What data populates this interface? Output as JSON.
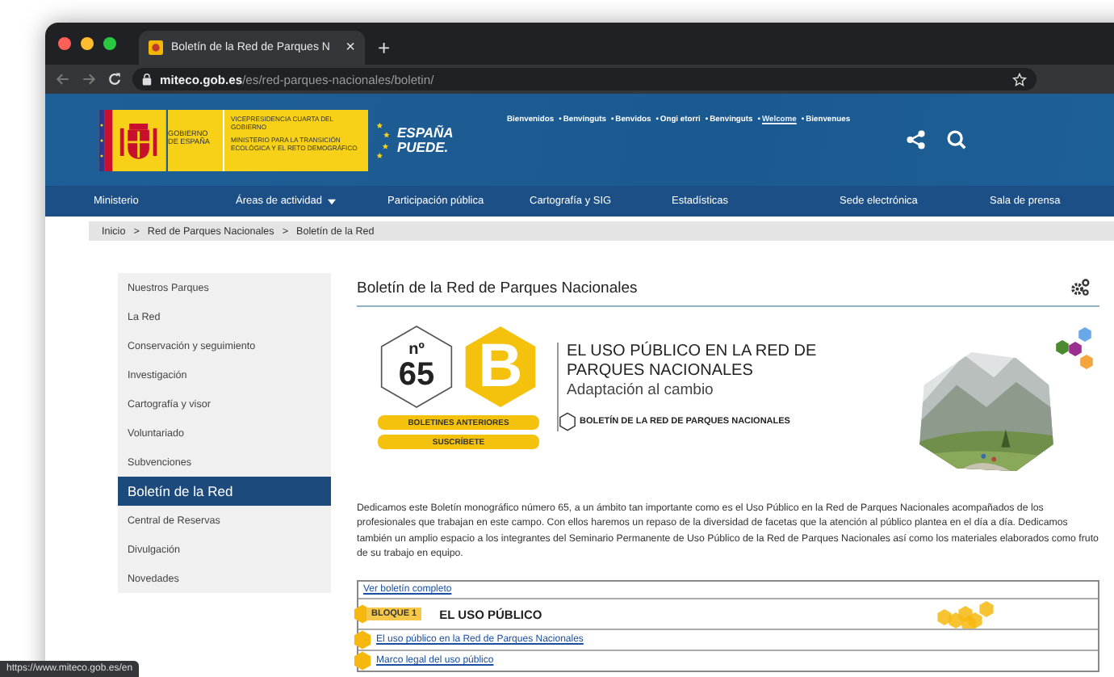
{
  "browser": {
    "tabs": [
      {
        "title": "Boletín de la Red de Parques N",
        "selected": true,
        "close": "×"
      }
    ],
    "new_tab": "+",
    "url": {
      "host": "miteco.gob.es",
      "path": "/es/red-parques-nacionales/boletin/"
    }
  },
  "header": {
    "logo": {
      "government": "GOBIERNO DE ESPAÑA",
      "vice": "VICEPRESIDENCIA CUARTA DEL GOBIERNO",
      "ministry": "MINISTERIO PARA LA TRANSICIÓN ECOLÓGICA Y EL RETO DEMOGRÁFICO"
    },
    "slogan": "ESPAÑA PUEDE.",
    "separator": "•",
    "languages": [
      {
        "label": "Bienvenidos",
        "selected": false
      },
      {
        "label": "Benvinguts",
        "selected": false
      },
      {
        "label": "Benvidos",
        "selected": false
      },
      {
        "label": "Ongi etorri",
        "selected": false
      },
      {
        "label": "Benvinguts",
        "selected": false
      },
      {
        "label": "Welcome",
        "selected": true
      },
      {
        "label": "Bienvenues",
        "selected": false
      }
    ]
  },
  "nav": [
    {
      "label": "Ministerio",
      "dropdown": false
    },
    {
      "label": "Áreas de actividad",
      "dropdown": true
    },
    {
      "label": "Participación pública",
      "dropdown": false
    },
    {
      "label": "Cartografía y SIG",
      "dropdown": false
    },
    {
      "label": "Estadísticas",
      "dropdown": false
    },
    {
      "label": "Sede electrónica",
      "dropdown": false
    },
    {
      "label": "Sala de prensa",
      "dropdown": false
    }
  ],
  "breadcrumb": {
    "separator": ">",
    "items": [
      "Inicio",
      "Red de Parques Nacionales",
      "Boletín de la Red"
    ]
  },
  "sidebar": [
    {
      "label": "Nuestros Parques",
      "selected": false
    },
    {
      "label": "La Red",
      "selected": false
    },
    {
      "label": "Conservación y seguimiento",
      "selected": false
    },
    {
      "label": "Investigación",
      "selected": false
    },
    {
      "label": "Cartografía y visor",
      "selected": false
    },
    {
      "label": "Voluntariado",
      "selected": false
    },
    {
      "label": "Subvenciones",
      "selected": false
    },
    {
      "label": "Boletín de la Red",
      "selected": true
    },
    {
      "label": "Central de Reservas",
      "selected": false
    },
    {
      "label": "Divulgación",
      "selected": false
    },
    {
      "label": "Novedades",
      "selected": false
    }
  ],
  "main": {
    "title": "Boletín de la Red de Parques Nacionales",
    "banner": {
      "number_label": "nº",
      "number": "65",
      "letter": "B",
      "buttons": [
        "BOLETINES ANTERIORES",
        "SUSCRÍBETE"
      ],
      "headline": "EL USO PÚBLICO EN LA RED DE PARQUES NACIONALES",
      "subtitle": "Adaptación al cambio",
      "series": "BOLETÍN DE LA RED DE PARQUES NACIONALES",
      "image": {
        "kind": "picture"
      }
    },
    "intro": "Dedicamos este  Boletín monográfico número 65, a un ámbito tan importante como es el Uso Público en la Red de Parques Nacionales acompañados de los profesionales que trabajan en este campo. Con ellos haremos un repaso de la diversidad de facetas que la atención al público plantea en el día a día. Dedicamos también un amplio espacio  a los integrantes del Seminario Permanente de Uso Público de la Red de Parques Nacionales así como los materiales elaborados como fruto de su trabajo en equipo.",
    "table": {
      "link": "Ver boletín completo",
      "block": {
        "badge": "BLOQUE 1",
        "title": "EL USO PÚBLICO"
      },
      "rows": [
        "El uso público en la Red de Parques Nacionales",
        "Marco legal del uso público"
      ]
    }
  },
  "status_url": "https://www.miteco.gob.es/en"
}
